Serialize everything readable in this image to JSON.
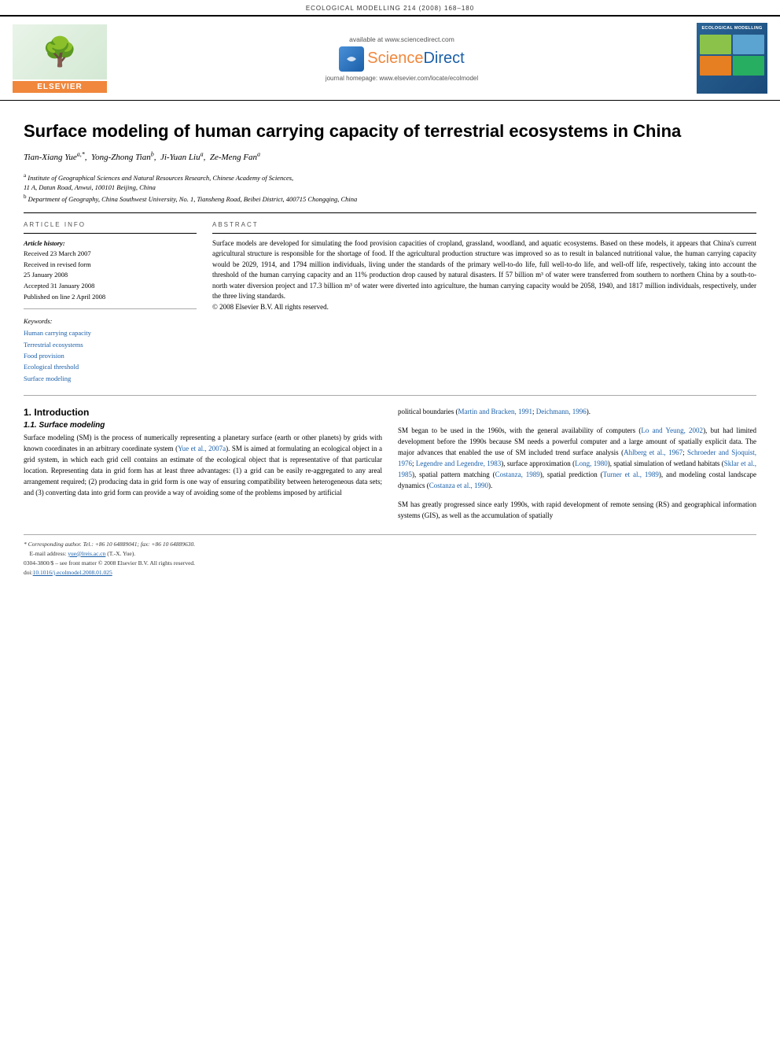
{
  "journal_header": {
    "text": "ECOLOGICAL MODELLING 214 (2008) 168–180"
  },
  "elsevier": {
    "label": "ELSEVIER"
  },
  "sciencedirect": {
    "available_text": "available at www.sciencedirect.com",
    "science": "Science",
    "direct": "Direct",
    "journal_text": "journal homepage: www.elsevier.com/locate/ecolmodel"
  },
  "journal_thumb": {
    "title": "ECOLOGICAL\nMODELLING"
  },
  "article": {
    "title": "Surface modeling of human carrying capacity of terrestrial ecosystems in China",
    "authors": [
      {
        "name": "Tian-Xiang Yue",
        "sup": "a,*"
      },
      {
        "name": "Yong-Zhong Tian",
        "sup": "b"
      },
      {
        "name": "Ji-Yuan Liu",
        "sup": "a"
      },
      {
        "name": "Ze-Meng Fan",
        "sup": "a"
      }
    ],
    "affiliations": [
      {
        "sup": "a",
        "text": "Institute of Geographical Sciences and Natural Resources Research, Chinese Academy of Sciences, 11A, Datun Road, Anwui, 100101 Beijing, China"
      },
      {
        "sup": "b",
        "text": "Department of Geography, China Southwest University, No. 1, Tiansheng Road, Beibei District, 400715 Chongqing, China"
      }
    ]
  },
  "article_info": {
    "section_label": "ARTICLE INFO",
    "history_label": "Article history:",
    "received": "Received 23 March 2007",
    "received_revised": "Received in revised form 25 January 2008",
    "accepted": "Accepted 31 January 2008",
    "published": "Published on line 2 April 2008",
    "keywords_label": "Keywords:",
    "keywords": [
      "Human carrying capacity",
      "Terrestrial ecosystems",
      "Food provision",
      "Ecological threshold",
      "Surface modeling"
    ]
  },
  "abstract": {
    "section_label": "ABSTRACT",
    "text": "Surface models are developed for simulating the food provision capacities of cropland, grassland, woodland, and aquatic ecosystems. Based on these models, it appears that China's current agricultural structure is responsible for the shortage of food. If the agricultural production structure was improved so as to result in balanced nutritional value, the human carrying capacity would be 2029, 1914, and 1794 million individuals, living under the standards of the primary well-to-do life, full well-to-do life, and well-off life, respectively, taking into account the threshold of the human carrying capacity and an 11% production drop caused by natural disasters. If 57 billion m³ of water were transferred from southern to northern China by a south-to-north water diversion project and 17.3 billion m³ of water were diverted into agriculture, the human carrying capacity would be 2058, 1940, and 1817 million individuals, respectively, under the three living standards.",
    "copyright": "© 2008 Elsevier B.V. All rights reserved."
  },
  "intro": {
    "section_num": "1.",
    "section_title": "Introduction",
    "subsection_num": "1.1.",
    "subsection_title": "Surface modeling",
    "para1": "Surface modeling (SM) is the process of numerically representing a planetary surface (earth or other planets) by grids with known coordinates in an arbitrary coordinate system (Yue et al., 2007a). SM is aimed at formulating an ecological object in a grid system, in which each grid cell contains an estimate of the ecological object that is representative of that particular location. Representing data in grid form has at least three advantages: (1) a grid can be easily re-aggregated to any areal arrangement required; (2) producing data in grid form is one way of ensuring compatibility between heterogeneous data sets; and (3) converting data into grid form can provide a way of avoiding some of the problems imposed by artificial",
    "para2": "political boundaries (Martin and Bracken, 1991; Deichmann, 1996).",
    "para3": "SM began to be used in the 1960s, with the general availability of computers (Lo and Yeung, 2002), but had limited development before the 1990s because SM needs a powerful computer and a large amount of spatially explicit data. The major advances that enabled the use of SM included trend surface analysis (Ahlberg et al., 1967; Schroeder and Sjoquist, 1976; Legendre and Legendre, 1983), surface approximation (Long, 1980), spatial simulation of wetland habitats (Sklar et al., 1985), spatial pattern matching (Costanza, 1989), spatial prediction (Turner et al., 1989), and modeling costal landscape dynamics (Costanza et al., 1990).",
    "para4": "SM has greatly progressed since early 1990s, with rapid development of remote sensing (RS) and geographical information systems (GIS), as well as the accumulation of spatially"
  },
  "footnotes": {
    "corr": "* Corresponding author. Tel.: +86 10 64889041; fax: +86 10 64889630.",
    "email_label": "E-mail address:",
    "email": "yue@lreis.ac.cn",
    "email_name": "(T.-X. Yue).",
    "front_matter": "0304-3800/$ – see front matter © 2008 Elsevier B.V. All rights reserved.",
    "doi": "doi:10.1016/j.ecolmodel.2008.01.025"
  }
}
